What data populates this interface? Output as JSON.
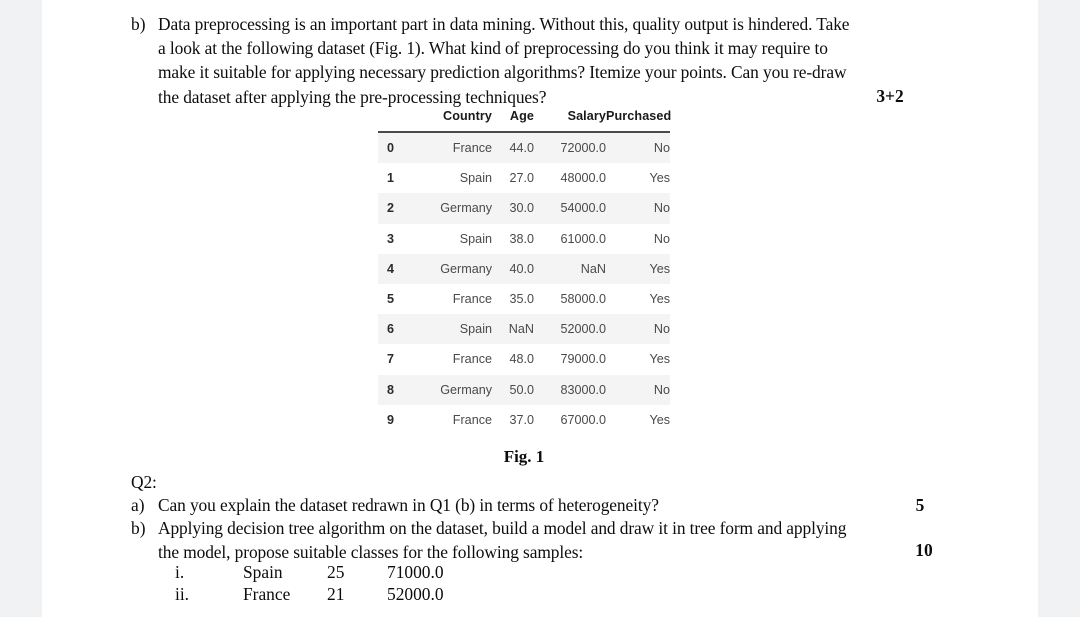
{
  "document": {
    "page_background": "#ffffff",
    "gutter_background": "#f1f2f4"
  },
  "question1": {
    "marker": "b)",
    "lines": [
      "Data preprocessing is an important part in data mining. Without this, quality output is hindered. Take",
      "a look at the following dataset (Fig. 1). What kind of preprocessing do you think it may require to",
      "make it suitable for applying necessary prediction algorithms? Itemize your points. Can you re-draw",
      "the dataset after applying the pre-processing techniques?"
    ],
    "marks": "3+2"
  },
  "dataframe": {
    "columns": [
      "Country",
      "Age",
      "Salary",
      "Purchased"
    ],
    "index": [
      "0",
      "1",
      "2",
      "3",
      "4",
      "5",
      "6",
      "7",
      "8",
      "9"
    ],
    "rows": [
      {
        "index": "0",
        "Country": "France",
        "Age": "44.0",
        "Salary": "72000.0",
        "Purchased": "No"
      },
      {
        "index": "1",
        "Country": "Spain",
        "Age": "27.0",
        "Salary": "48000.0",
        "Purchased": "Yes"
      },
      {
        "index": "2",
        "Country": "Germany",
        "Age": "30.0",
        "Salary": "54000.0",
        "Purchased": "No"
      },
      {
        "index": "3",
        "Country": "Spain",
        "Age": "38.0",
        "Salary": "61000.0",
        "Purchased": "No"
      },
      {
        "index": "4",
        "Country": "Germany",
        "Age": "40.0",
        "Salary": "NaN",
        "Purchased": "Yes"
      },
      {
        "index": "5",
        "Country": "France",
        "Age": "35.0",
        "Salary": "58000.0",
        "Purchased": "Yes"
      },
      {
        "index": "6",
        "Country": "Spain",
        "Age": "NaN",
        "Salary": "52000.0",
        "Purchased": "No"
      },
      {
        "index": "7",
        "Country": "France",
        "Age": "48.0",
        "Salary": "79000.0",
        "Purchased": "Yes"
      },
      {
        "index": "8",
        "Country": "Germany",
        "Age": "50.0",
        "Salary": "83000.0",
        "Purchased": "No"
      },
      {
        "index": "9",
        "Country": "France",
        "Age": "37.0",
        "Salary": "67000.0",
        "Purchased": "Yes"
      }
    ]
  },
  "figure": {
    "caption": "Fig. 1"
  },
  "question2": {
    "heading": "Q2:",
    "items": [
      {
        "marker": "a)",
        "lines": [
          "Can you explain the dataset redrawn in Q1 (b) in terms of heterogeneity?"
        ],
        "marks": "5"
      },
      {
        "marker": "b)",
        "lines": [
          "Applying decision tree algorithm on the dataset, build a model and draw it in tree form and applying",
          "the model, propose suitable classes for the following samples:"
        ],
        "marks": "10"
      }
    ],
    "samples": [
      {
        "numeral": "i.",
        "country": "Spain",
        "age": "25",
        "salary": "71000.0"
      },
      {
        "numeral": "ii.",
        "country": "France",
        "age": "21",
        "salary": "52000.0"
      }
    ]
  }
}
